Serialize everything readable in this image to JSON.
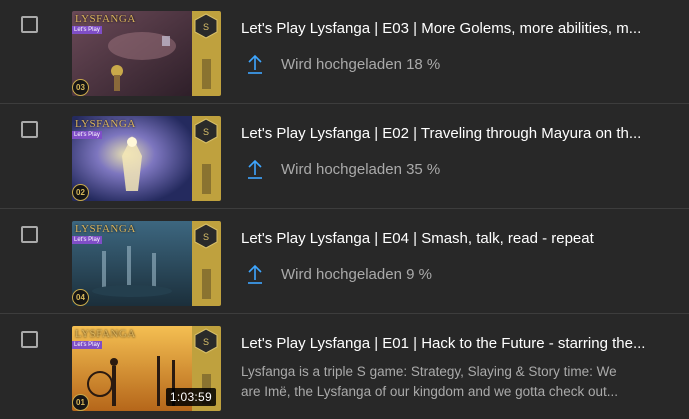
{
  "videos": [
    {
      "title": "Let's Play Lysfanga | E03 | More Golems, more abilities, m...",
      "thumb_title": "LYSFANGA",
      "thumb_tag": "Let's Play",
      "episode_badge": "03",
      "thumb_colors": [
        "#3e2a34",
        "#8a5f6a",
        "#5a4050"
      ],
      "status_icon": "upload-arrow-icon",
      "status_text": "Wird hochgeladen 18 %",
      "progress_percent": 18
    },
    {
      "title": "Let's Play Lysfanga | E02 | Traveling through Mayura on th...",
      "thumb_title": "LYSFANGA",
      "thumb_tag": "Let's Play",
      "episode_badge": "02",
      "thumb_colors": [
        "#2a2f6a",
        "#8e86c9",
        "#d8c27a"
      ],
      "status_icon": "upload-arrow-icon",
      "status_text": "Wird hochgeladen 35 %",
      "progress_percent": 35
    },
    {
      "title": "Let's Play Lysfanga | E04 | Smash, talk, read - repeat",
      "thumb_title": "LYSFANGA",
      "thumb_tag": "Let's Play",
      "episode_badge": "04",
      "thumb_colors": [
        "#1f3a4a",
        "#4b7286",
        "#2a4e5e"
      ],
      "status_icon": "upload-arrow-icon",
      "status_text": "Wird hochgeladen 9 %",
      "progress_percent": 9
    },
    {
      "title": "Let's Play Lysfanga | E01 | Hack to the Future - starring the...",
      "thumb_title": "LYSFANGA",
      "thumb_tag": "Let's Play",
      "episode_badge": "01",
      "thumb_colors": [
        "#c77a1e",
        "#f0b043",
        "#2a1a10"
      ],
      "duration": "1:03:59",
      "description_line1": "Lysfanga is a triple S game: Strategy, Slaying & Story time: We",
      "description_line2": "are Imë, the Lysfanga of our kingdom and we gotta check out..."
    }
  ],
  "colors": {
    "background": "#282828",
    "title_text": "#ffffff",
    "secondary_text": "#aaaaaa",
    "upload_icon": "#3ea6ff",
    "logo_gold": "#bfa13e"
  }
}
